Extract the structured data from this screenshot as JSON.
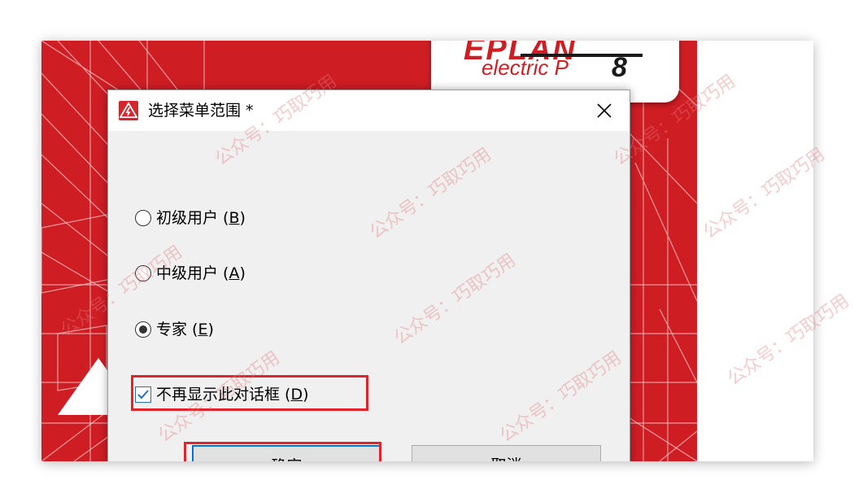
{
  "dialog": {
    "title": "选择菜单范围 *",
    "options": [
      {
        "label": "初级用户 (",
        "hotkey": "B",
        "close": ")",
        "checked": false
      },
      {
        "label": "中级用户 (",
        "hotkey": "A",
        "close": ")",
        "checked": false
      },
      {
        "label": "专家 (",
        "hotkey": "E",
        "close": ")",
        "checked": true
      }
    ],
    "dont_show_again": {
      "label": "不再显示此对话框 (",
      "hotkey": "D",
      "close": ")",
      "checked": true
    },
    "ok_label": "确定",
    "cancel_label": "取消"
  },
  "splash": {
    "logo_text": "EPLAN",
    "logo_sub": "electric P",
    "logo_version": "8"
  },
  "watermark": "公众号：巧取巧用",
  "colors": {
    "brand_red": "#cf1d24",
    "highlight_red": "#e0242c",
    "focus_blue": "#0a6fd6"
  },
  "icons": {
    "app": "lightning-warning-icon",
    "close": "close-icon",
    "checkbox": "checkmark-icon"
  }
}
